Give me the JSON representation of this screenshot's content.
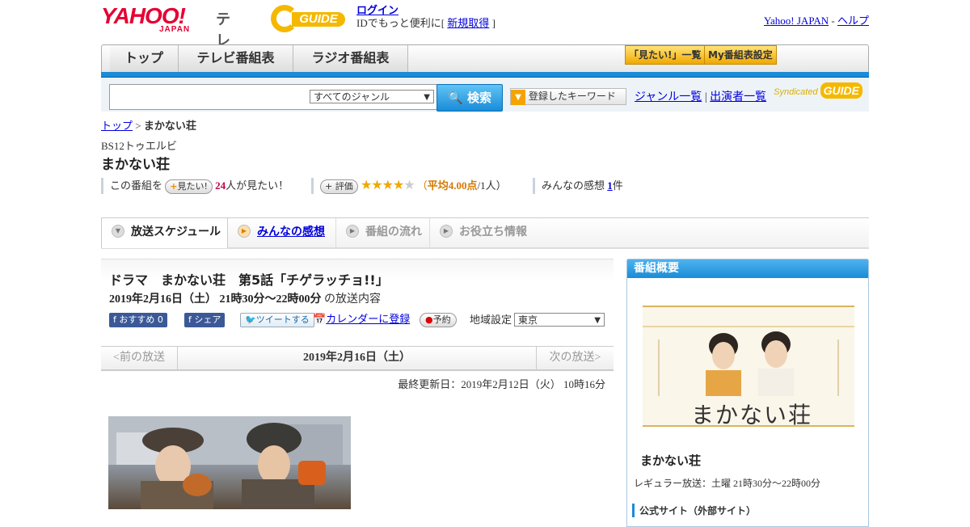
{
  "header": {
    "logo_main": "YAHOO!",
    "logo_sub": "JAPAN",
    "logo_tv": "テレビ",
    "gguide": "GUIDE",
    "login_link": "ログイン",
    "login_prefix": "IDでもっと便利に[ ",
    "signup_link": "新規取得",
    "login_suffix": " ]",
    "yahoo_japan_link": "Yahoo! JAPAN",
    "separator": " - ",
    "help_link": "ヘルプ"
  },
  "nav": {
    "tabs": [
      "トップ",
      "テレビ番組表",
      "ラジオ番組表"
    ],
    "mitai_list": "「見たい!」一覧",
    "my_schedule": "My番組表設定"
  },
  "search": {
    "genre_selected": "すべてのジャンル",
    "search_button": "検索",
    "keyword_button": "登録したキーワード",
    "genre_list": "ジャンル一覧",
    "divider": "|",
    "cast_list": "出演者一覧",
    "syndicated": "Syndicated",
    "syndicated_logo": "GUIDE"
  },
  "breadcrumb": {
    "top": "トップ",
    "sep": " > ",
    "current": "まかない荘"
  },
  "program": {
    "channel": "BS12トゥエルビ",
    "title": "まかない荘",
    "this_program": "この番組を",
    "mitai_button": "見たい!",
    "mitai_count": "24",
    "mitai_suffix": "人が見たい！",
    "rate_button": "評価",
    "rating_prefix": "（",
    "rating_label": "平均",
    "rating_value": "4.00点",
    "rating_suffix": "/1人）",
    "rating": 4,
    "impressions_label": "みんなの感想 ",
    "impressions_count": "1",
    "impressions_suffix": "件"
  },
  "subtabs": [
    "放送スケジュール",
    "みんなの感想",
    "番組の流れ",
    "お役立ち情報"
  ],
  "episode": {
    "heading": "ドラマ　まかない荘　第5話「チゲラッチョ!!」",
    "datetime": "2019年2月16日（土）  21時30分～22時00分",
    "datetime_suffix": " の放送内容",
    "recommend": "おすすめ 0",
    "share": "シェア",
    "tweet": "ツイートする",
    "calendar": "カレンダーに登録",
    "reserve": "予約",
    "region_label": "地域設定",
    "region_value": "東京"
  },
  "pager": {
    "prev": "<前の放送",
    "current": "2019年2月16日（土）",
    "next": "次の放送>"
  },
  "last_updated": "最終更新日：2019年2月12日（火）  10時16分",
  "side": {
    "header": "番組概要",
    "poster_title": "まかない荘",
    "name": "まかない荘",
    "regular": "レギュラー放送：土曜 21時30分～22時00分",
    "official": "公式サイト（外部サイト）"
  }
}
